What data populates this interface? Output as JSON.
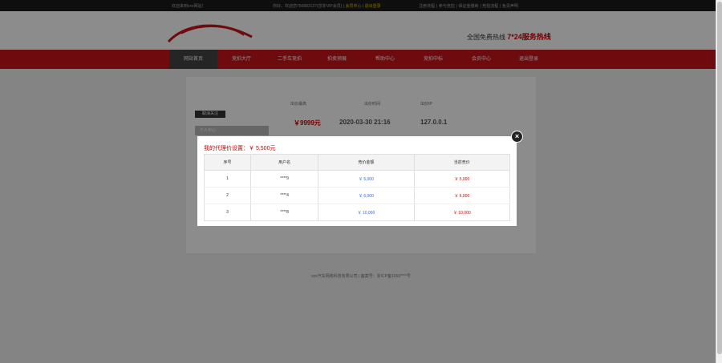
{
  "topbar": {
    "welcome": "欢迎来到xxx网站！",
    "greeting": "你好，欢迎您756883127(您非VIP会员)",
    "member_center": "会员中心",
    "logout": "退出登录",
    "links": [
      "注册流程",
      "参与竞拍",
      "保证金缴纳",
      "竞拍流程",
      "免责声明"
    ]
  },
  "header": {
    "hotline_label": "全国免费热线",
    "hotline_value": "7*24服务热线"
  },
  "nav": {
    "items": [
      "网站首页",
      "竞拍大厅",
      "二手车竞拍",
      "拍卖预展",
      "帮助中心",
      "竞拍中标",
      "会员中心",
      "退出登录"
    ],
    "active_index": 0
  },
  "summary": {
    "headers": [
      "出价最高",
      "出价时间",
      "出价IP"
    ],
    "price": "￥9999元",
    "time": "2020-03-30 21:16",
    "ip": "127.0.0.1"
  },
  "sidebar": {
    "button": "取消关注",
    "menu_item": "个人中心"
  },
  "footer": {
    "text": "xxx汽车网络科技有限公司 | 备案号：浙ICP备1650****号"
  },
  "modal": {
    "title": "我的代理价设置：￥ 5,500元",
    "close": "×",
    "columns": [
      "序号",
      "用户名",
      "竞价金额",
      "当前竞价"
    ],
    "rows": [
      {
        "no": "1",
        "user": "****9",
        "bid": "￥ 5,000",
        "current": "￥ 5,000"
      },
      {
        "no": "2",
        "user": "****4",
        "bid": "￥ 6,000",
        "current": "￥ 6,000"
      },
      {
        "no": "3",
        "user": "****8",
        "bid": "￥ 10,000",
        "current": "￥ 10,000"
      }
    ]
  },
  "colors": {
    "brand_red": "#c8151b",
    "price_red": "#cc0000",
    "bid_blue": "#2a6ad8",
    "topbar_dark": "#1b1b1b"
  }
}
